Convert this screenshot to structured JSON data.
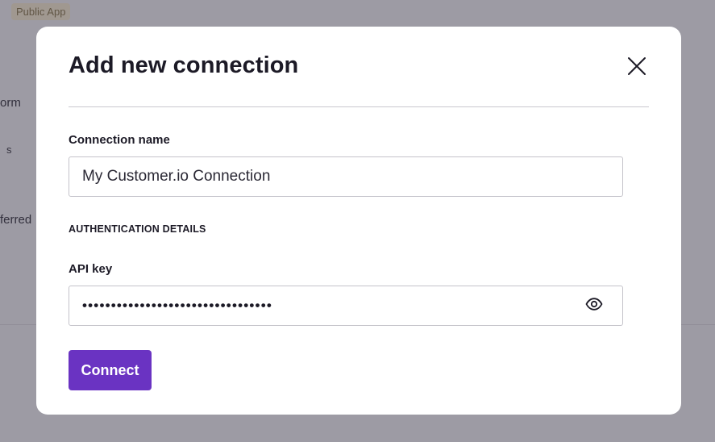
{
  "background": {
    "badge": "Public App",
    "fragments": [
      "orm",
      "s",
      "ferred"
    ]
  },
  "modal": {
    "title": "Add new connection",
    "close_icon": "close-icon",
    "connection_name": {
      "label": "Connection name",
      "value": "My Customer.io Connection"
    },
    "auth_section_heading": "AUTHENTICATION DETAILS",
    "api_key": {
      "label": "API key",
      "masked_value": "•••••••••••••••••••••••••••••••••",
      "toggle_icon": "eye-icon"
    },
    "connect_label": "Connect"
  },
  "colors": {
    "accent": "#6a33c2",
    "overlay": "#28243466",
    "title_text": "#1c1a26"
  }
}
